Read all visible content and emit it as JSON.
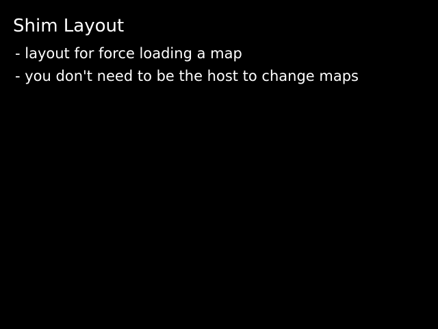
{
  "slide": {
    "title": "Shim Layout",
    "notes": [
      "- layout for force loading a map",
      "- you don't need to be the host to change maps"
    ],
    "background_color": "#000000",
    "text_color": "#ffffff"
  }
}
